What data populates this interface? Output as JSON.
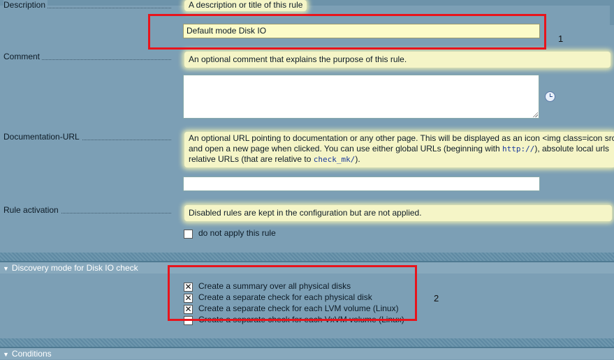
{
  "description": {
    "label": "Description",
    "help": "A description or title of this rule",
    "value": "Default mode Disk IO"
  },
  "comment": {
    "label": "Comment",
    "help": "An optional comment that explains the purpose of this rule."
  },
  "documentation_url": {
    "label": "Documentation-URL",
    "help_line1": "An optional URL pointing to documentation or any other page. This will be displayed as an icon <img class=icon src",
    "help_line2_a": "and open a new page when clicked. You can use either global URLs (beginning with ",
    "help_line2_code": "http://",
    "help_line2_b": "), absolute local urls",
    "help_line3_a": "relative URLs (that are relative to ",
    "help_line3_code": "check_mk/",
    "help_line3_b": ")."
  },
  "rule_activation": {
    "label": "Rule activation",
    "help": "Disabled rules are kept in the configuration but are not applied.",
    "checkbox_label": "do not apply this rule"
  },
  "discovery_section": {
    "title": "Discovery mode for Disk IO check",
    "options": [
      {
        "label": "Create a summary over all physical disks",
        "checked": true
      },
      {
        "label": "Create a separate check for each physical disk",
        "checked": true
      },
      {
        "label": "Create a separate check for each LVM volume (Linux)",
        "checked": true
      },
      {
        "label": "Create a separate check for each VxVM volume (Linux)",
        "checked": false
      }
    ]
  },
  "conditions_section": {
    "title": "Conditions"
  },
  "annotations": {
    "box1": "1",
    "box2": "2"
  }
}
